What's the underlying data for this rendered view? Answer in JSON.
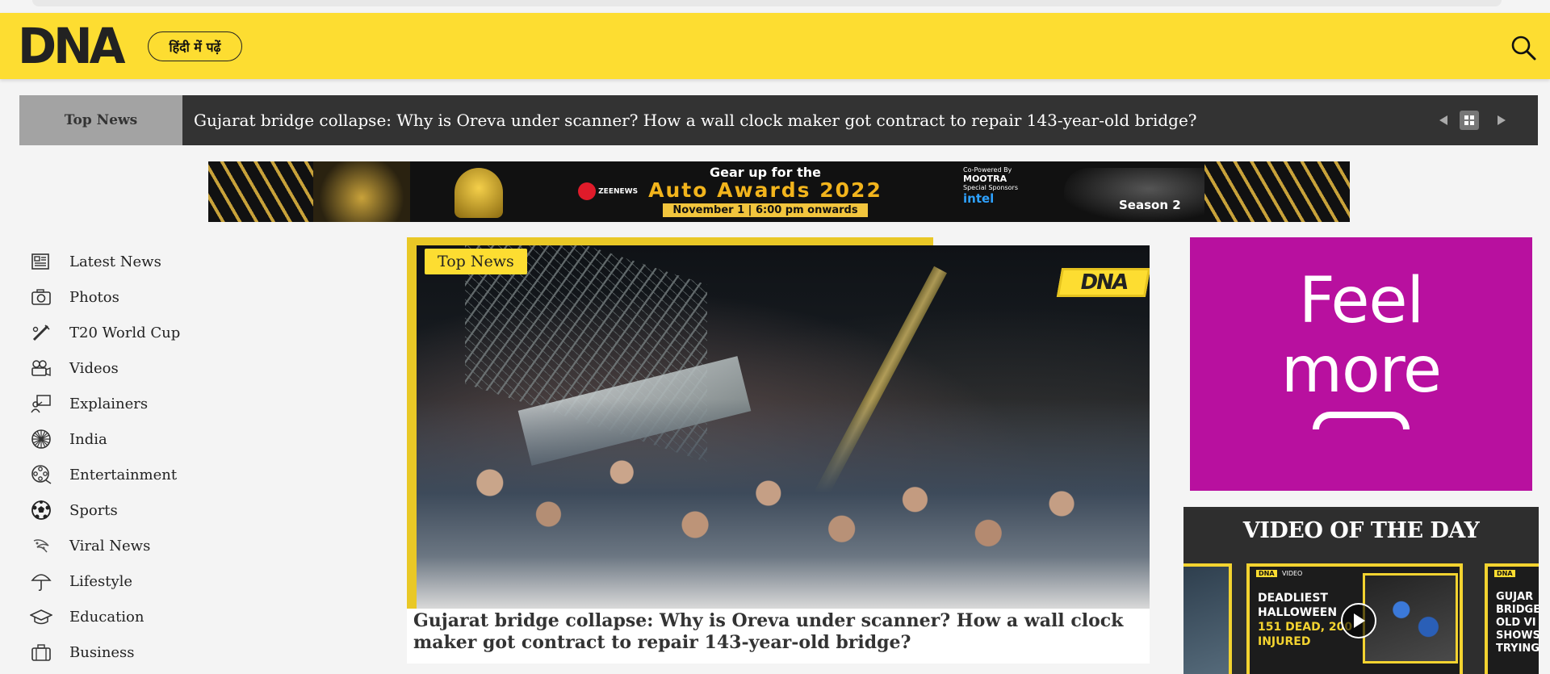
{
  "header": {
    "logo_text": "DNA",
    "hindi_button_label": "हिंदी में पढ़ें",
    "background_color": "#fddd31"
  },
  "ticker": {
    "label": "Top News",
    "headline": "Gujarat bridge collapse: Why is Oreva under scanner? How a wall clock maker got contract to repair 143-year-old bridge?"
  },
  "banner": {
    "line1": "Gear up for the",
    "line2": "Auto Awards 2022",
    "line3": "November 1 | 6:00 pm onwards",
    "brand": "ZEENEWS",
    "copowered": "Co-Powered By",
    "copowered_brand": "MOOTRA",
    "special_sponsors": "Special Sponsors",
    "sponsor": "intel",
    "season": "Season 2"
  },
  "sidebar": {
    "items": [
      {
        "label": "Latest News",
        "icon": "newspaper-icon"
      },
      {
        "label": "Photos",
        "icon": "camera-icon"
      },
      {
        "label": "T20 World Cup",
        "icon": "cricket-bat-icon"
      },
      {
        "label": "Videos",
        "icon": "video-camera-icon"
      },
      {
        "label": "Explainers",
        "icon": "presenter-icon"
      },
      {
        "label": "India",
        "icon": "ashoka-chakra-icon"
      },
      {
        "label": "Entertainment",
        "icon": "film-reel-icon"
      },
      {
        "label": "Sports",
        "icon": "football-icon"
      },
      {
        "label": "Viral News",
        "icon": "viral-icon"
      },
      {
        "label": "Lifestyle",
        "icon": "umbrella-icon"
      },
      {
        "label": "Education",
        "icon": "graduation-cap-icon"
      },
      {
        "label": "Business",
        "icon": "briefcase-icon"
      }
    ]
  },
  "hero": {
    "tag": "Top News",
    "watermark": "DNA",
    "caption": "Gujarat bridge collapse: Why is Oreva under scanner? How a wall clock maker got contract to repair 143-year-old bridge?"
  },
  "ad": {
    "line1": "Feel",
    "line2": "more",
    "background_color": "#b8109f"
  },
  "video_of_the_day": {
    "title": "VIDEO OF THE DAY",
    "card_tag": "DNA",
    "card_label": "VIDEO",
    "card_title_white": "DEADLIEST HALLOWEEN",
    "card_title_yellow": "151 DEAD, 200 INJURED",
    "next_card_text": "GUJAR BRIDGE OLD VI SHOWS TRYING"
  }
}
